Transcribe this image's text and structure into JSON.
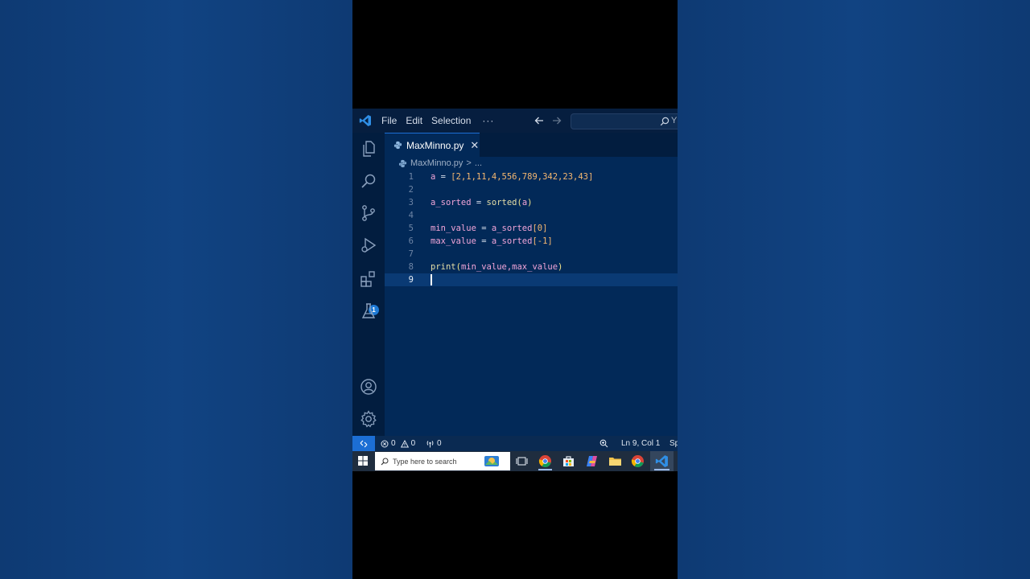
{
  "menu": {
    "file": "File",
    "edit": "Edit",
    "selection": "Selection",
    "more": "···"
  },
  "search": {
    "stub": "Y"
  },
  "activity": {
    "extensions_badge": "1"
  },
  "tab": {
    "filename": "MaxMinno.py",
    "close": "✕"
  },
  "breadcrumb": {
    "file": "MaxMinno.py",
    "separator": ">",
    "more": "..."
  },
  "editor": {
    "lines": [
      {
        "no": "1",
        "text": "a = [2,1,11,4,556,789,342,23,43]"
      },
      {
        "no": "2",
        "text": ""
      },
      {
        "no": "3",
        "text": "a_sorted = sorted(a)"
      },
      {
        "no": "4",
        "text": ""
      },
      {
        "no": "5",
        "text": "min_value = a_sorted[0]"
      },
      {
        "no": "6",
        "text": "max_value = a_sorted[-1]"
      },
      {
        "no": "7",
        "text": ""
      },
      {
        "no": "8",
        "text": "print(min_value,max_value)"
      },
      {
        "no": "9",
        "text": ""
      }
    ],
    "tokens": {
      "l1_var": "a",
      "l1_eq": " = ",
      "l1_list": "[2,1,11,4,556,789,342,23,43]",
      "l3_var": "a_sorted",
      "l3_eq": " = ",
      "l3_fn": "sorted",
      "l3_open": "(",
      "l3_arg": "a",
      "l3_close": ")",
      "l5_var": "min_value",
      "l5_eq": " = ",
      "l5_ref": "a_sorted",
      "l5_idx": "[0]",
      "l6_var": "max_value",
      "l6_eq": " = ",
      "l6_ref": "a_sorted",
      "l6_idx": "[-1]",
      "l8_fn": "print",
      "l8_open": "(",
      "l8_args": "min_value,max_value",
      "l8_close": ")"
    },
    "cursor_line": 9
  },
  "statusbar": {
    "errors": "0",
    "warnings": "0",
    "ports": "0",
    "position": "Ln 9, Col 1",
    "spaces_stub": "Sp"
  },
  "taskbar": {
    "search_placeholder": "Type here to search"
  },
  "colors": {
    "accent": "#1c6ed4",
    "editor_bg": "#022958",
    "page_bg": "#0f3e79"
  }
}
